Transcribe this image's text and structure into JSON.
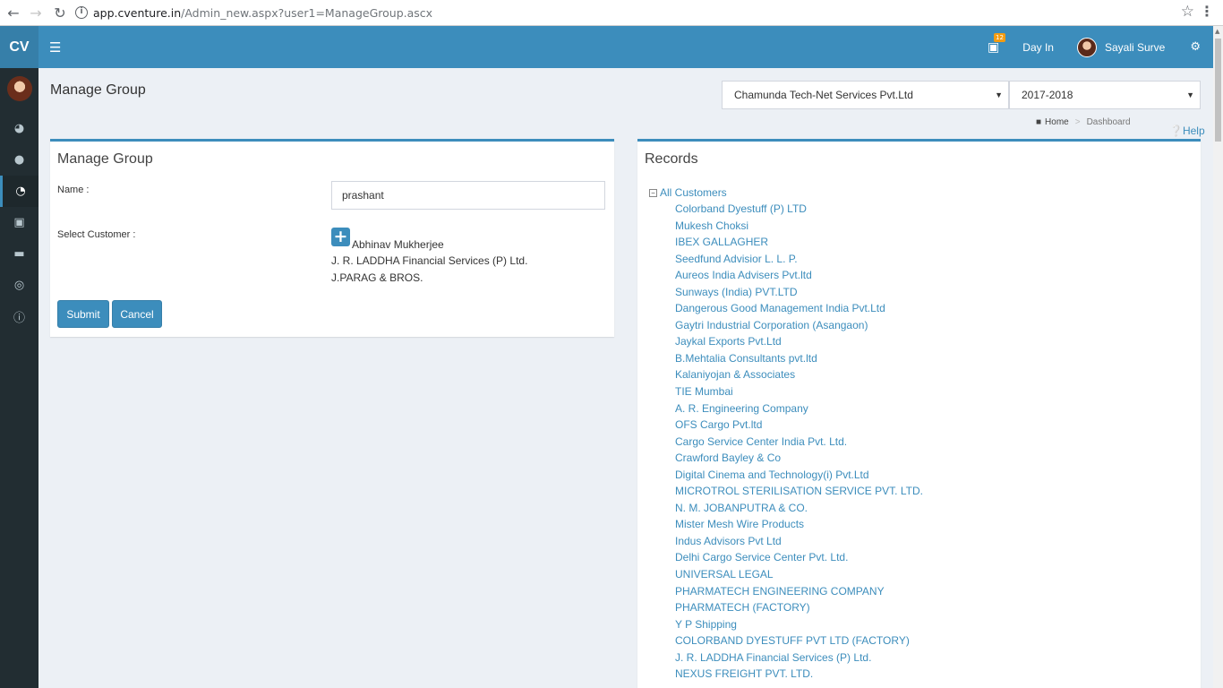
{
  "browser": {
    "url_host": "app.cventure.in",
    "url_path": "/Admin_new.aspx?user1=ManageGroup.ascx"
  },
  "header": {
    "logo": "CV",
    "notification_count": "12",
    "day_in_label": "Day In",
    "user_name": "Sayali Surve",
    "icons": [
      "menu-icon",
      "bell-icon",
      "user-avatar",
      "cogs-icon"
    ],
    "accent_color": "#3c8dbc"
  },
  "sidebar": {
    "icons": [
      "dashboard-icon",
      "user-icon",
      "pie-chart-icon",
      "cart-icon",
      "credit-card-icon",
      "life-ring-icon",
      "info-icon"
    ]
  },
  "page": {
    "title": "Manage Group",
    "company_select": "Chamunda Tech-Net Services Pvt.Ltd",
    "year_select": "2017-2018",
    "breadcrumb_home": "Home",
    "breadcrumb_current": "Dashboard",
    "help_label": "Help"
  },
  "manage_group": {
    "title": "Manage Group",
    "name_label": "Name :",
    "name_value": "prashant",
    "select_customer_label": "Select Customer :",
    "selected_customers": [
      "Abhinav Mukherjee",
      "J. R. LADDHA Financial Services (P) Ltd.",
      "J.PARAG & BROS."
    ],
    "submit_label": "Submit",
    "cancel_label": "Cancel"
  },
  "records": {
    "title": "Records",
    "root_label": "All Customers",
    "items": [
      "Colorband Dyestuff (P) LTD",
      "Mukesh Choksi",
      "IBEX GALLAGHER",
      "Seedfund Advisior L. L. P.",
      "Aureos India Advisers Pvt.ltd",
      "Sunways (India) PVT.LTD",
      "Dangerous Good Management India Pvt.Ltd",
      "Gaytri Industrial Corporation (Asangaon)",
      "Jaykal Exports Pvt.Ltd",
      "B.Mehtalia Consultants pvt.ltd",
      "Kalaniyojan & Associates",
      "TIE Mumbai",
      "A. R. Engineering Company",
      "OFS Cargo Pvt.ltd",
      "Cargo Service Center India Pvt. Ltd.",
      "Crawford Bayley & Co",
      "Digital Cinema and Technology(i) Pvt.Ltd",
      "MICROTROL STERILISATION SERVICE PVT. LTD.",
      "N. M. JOBANPUTRA & CO.",
      "Mister Mesh Wire Products",
      "Indus Advisors Pvt Ltd",
      "Delhi Cargo Service Center Pvt. Ltd.",
      "UNIVERSAL LEGAL",
      "PHARMATECH ENGINEERING COMPANY",
      "PHARMATECH (FACTORY)",
      "Y P Shipping",
      "COLORBAND DYESTUFF PVT LTD (FACTORY)",
      "J. R. LADDHA Financial Services (P) Ltd.",
      "NEXUS FREIGHT PVT. LTD."
    ]
  }
}
